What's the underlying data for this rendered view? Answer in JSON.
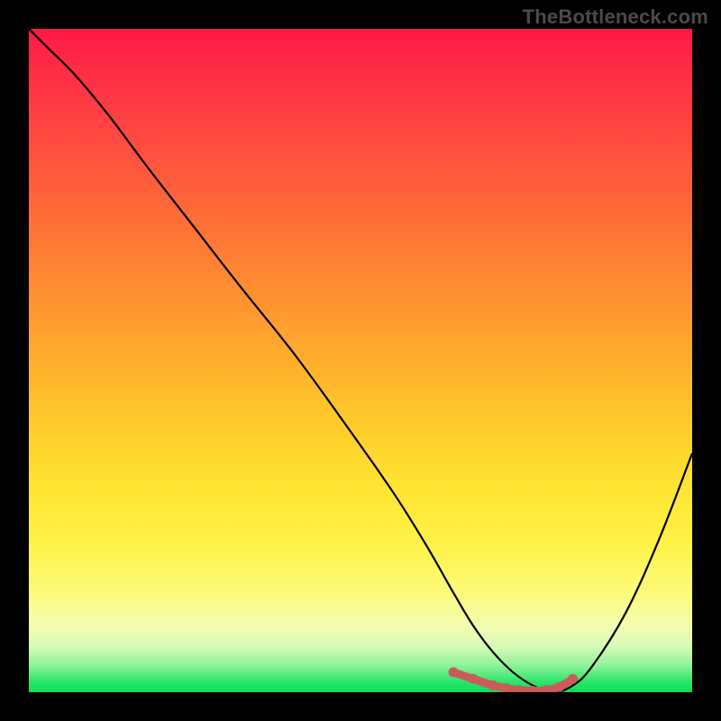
{
  "watermark": "TheBottleneck.com",
  "colors": {
    "frame": "#000000",
    "curve": "#000000",
    "marker": "#cc5a5a",
    "gradient_top": "#ff1846",
    "gradient_bottom": "#0adf58"
  },
  "chart_data": {
    "type": "line",
    "title": "",
    "xlabel": "",
    "ylabel": "",
    "xlim": [
      0,
      100
    ],
    "ylim": [
      0,
      100
    ],
    "series": [
      {
        "name": "bottleneck-curve",
        "x": [
          0,
          3,
          7,
          12,
          18,
          25,
          32,
          40,
          48,
          55,
          60,
          64,
          67,
          70,
          73,
          76,
          79,
          82,
          85,
          90,
          95,
          100
        ],
        "values": [
          100,
          97,
          93,
          87,
          79,
          70,
          61,
          51,
          40,
          30,
          22,
          15,
          10,
          6,
          3,
          1,
          0,
          1,
          4,
          12,
          23,
          36
        ]
      }
    ],
    "markers": {
      "name": "low-bottleneck-region",
      "x": [
        64,
        67,
        70,
        72,
        74,
        76,
        78,
        80,
        82
      ],
      "values": [
        3,
        2,
        1,
        0.6,
        0.3,
        0.2,
        0.3,
        0.8,
        2
      ]
    }
  }
}
